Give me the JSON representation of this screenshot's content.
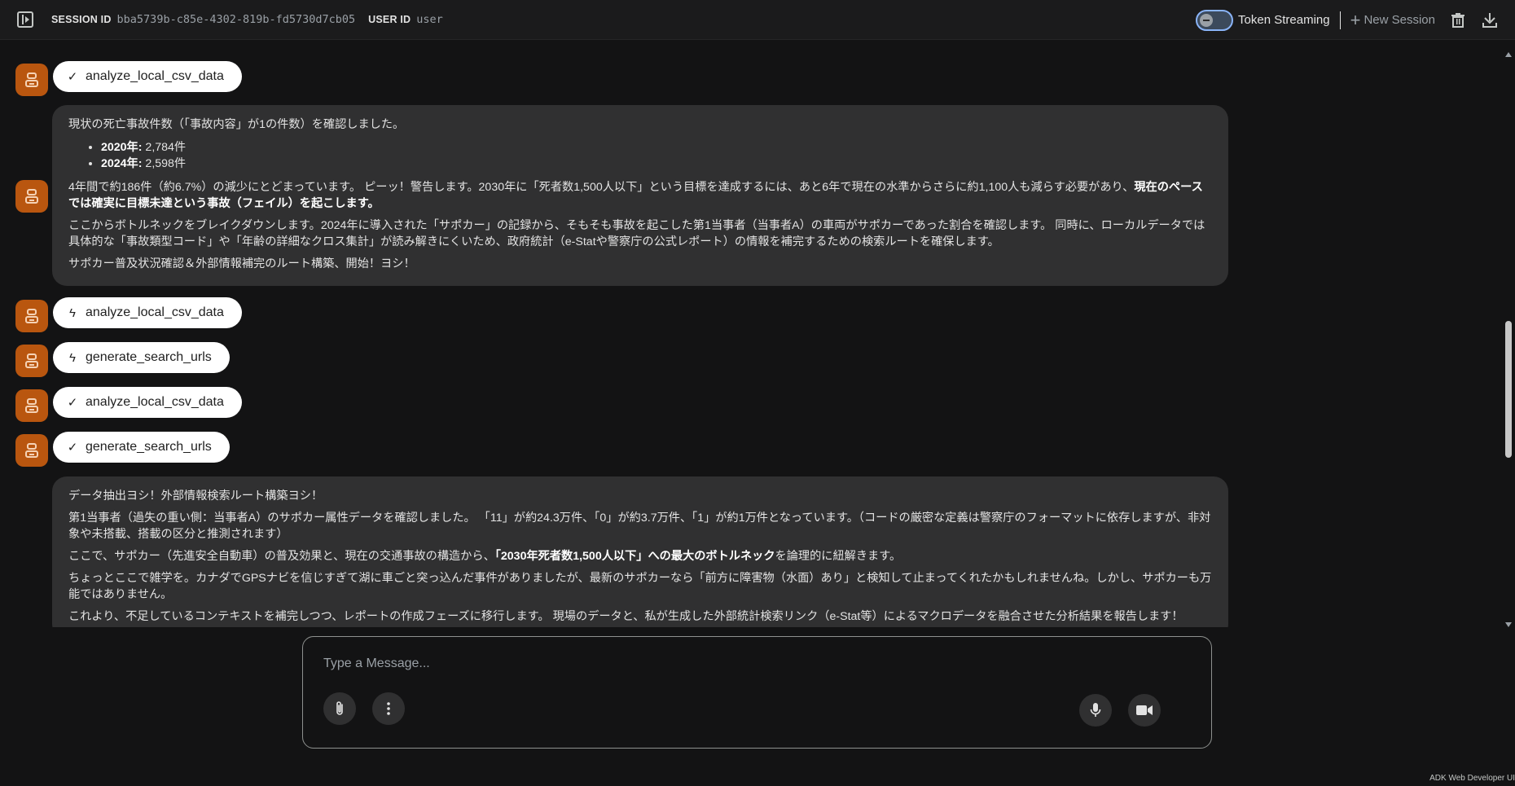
{
  "header": {
    "session_label": "SESSION ID",
    "session_id": "bba5739b-c85e-4302-819b-fd5730d7cb05",
    "user_label": "USER ID",
    "user_id": "user",
    "token_streaming_label": "Token Streaming",
    "token_streaming_on": false,
    "new_session_label": "New Session"
  },
  "messages": {
    "tool1": {
      "icon": "check",
      "glyph": "✓",
      "name": "analyze_local_csv_data"
    },
    "text1": {
      "intro": "現状の死亡事故件数（「事故内容」が1の件数）を確認しました。",
      "bullets": [
        {
          "year": "2020年:",
          "value": " 2,784件"
        },
        {
          "year": "2024年:",
          "value": " 2,598件"
        }
      ],
      "p1_plain": "4年間で約186件（約6.7%）の減少にとどまっています。 ピーッ！警告します。2030年に「死者数1,500人以下」という目標を達成するには、あと6年で現在の水準からさらに約1,100人も減らす必要があり、",
      "p1_bold": "現在のペースでは確実に目標未達という事故（フェイル）を起こします。",
      "p2": "ここからボトルネックをブレイクダウンします。2024年に導入された「サポカー」の記録から、そもそも事故を起こした第1当事者（当事者A）の車両がサポカーであった割合を確認します。 同時に、ローカルデータでは具体的な「事故類型コード」や「年齢の詳細なクロス集計」が読み解きにくいため、政府統計（e-Statや警察庁の公式レポート）の情報を補完するための検索ルートを確保します。",
      "p3": "サポカー普及状況確認＆外部情報補完のルート構築、開始！ヨシ！"
    },
    "tool2": {
      "icon": "bolt",
      "glyph": "ϟ",
      "name": "analyze_local_csv_data"
    },
    "tool3": {
      "icon": "bolt",
      "glyph": "ϟ",
      "name": "generate_search_urls"
    },
    "tool4": {
      "icon": "check",
      "glyph": "✓",
      "name": "analyze_local_csv_data"
    },
    "tool5": {
      "icon": "check",
      "glyph": "✓",
      "name": "generate_search_urls"
    },
    "text2": {
      "p1": "データ抽出ヨシ！外部情報検索ルート構築ヨシ！",
      "p2": "第1当事者（過失の重い側：当事者A）のサポカー属性データを確認しました。 「11」が約24.3万件、「0」が約3.7万件、「1」が約1万件となっています。（コードの厳密な定義は警察庁のフォーマットに依存しますが、非対象や未搭載、搭載の区分と推測されます）",
      "p3_a": "ここで、サポカー（先進安全自動車）の普及効果と、現在の交通事故の構造から、",
      "p3_bold": "「2030年死者数1,500人以下」への最大のボトルネック",
      "p3_b": "を論理的に紐解きます。",
      "p4": "ちょっとここで雑学を。カナダでGPSナビを信じすぎて湖に車ごと突っ込んだ事件がありましたが、最新のサポカーなら「前方に障害物（水面）あり」と検知して止まってくれたかもしれませんね。しかし、サポカーも万能ではありません。",
      "p5": "これより、不足しているコンテキストを補完しつつ、レポートの作成フェーズに移行します。 現場のデータと、私が生成した外部統計検索リンク（e-Stat等）によるマクロデータを融合させた分析結果を報告します！"
    }
  },
  "composer": {
    "placeholder": "Type a Message..."
  },
  "icons": {
    "sidebar": "sidebar-toggle-icon",
    "attach": "paperclip-icon",
    "more": "more-vert-icon",
    "mic": "mic-icon",
    "camera": "videocam-icon",
    "trash": "trash-icon",
    "download": "download-icon",
    "agent": "robot-icon"
  },
  "colors": {
    "background": "#131314",
    "bubble": "#303031",
    "avatar": "#b9560f",
    "toggle_border": "#8ab4f8"
  },
  "footer": "ADK Web Developer UI"
}
